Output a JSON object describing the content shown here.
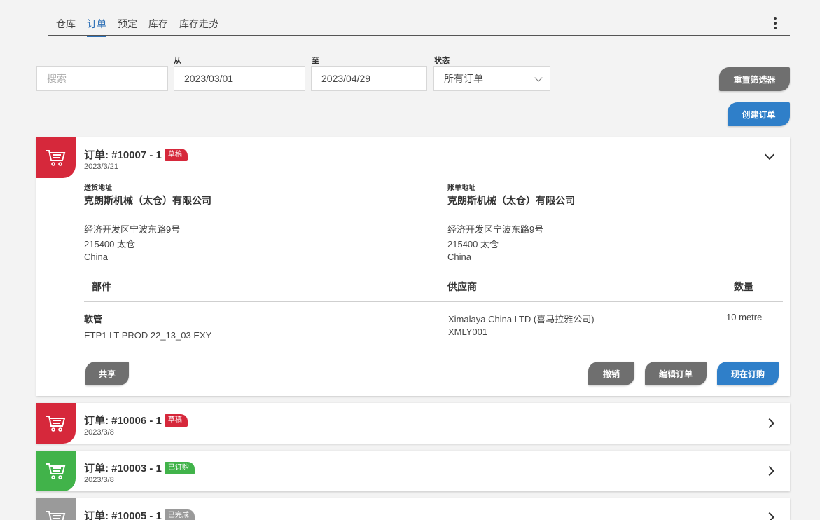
{
  "tabs": [
    {
      "label": "仓库"
    },
    {
      "label": "订单"
    },
    {
      "label": "预定"
    },
    {
      "label": "库存"
    },
    {
      "label": "库存走势"
    }
  ],
  "active_tab": "订单",
  "filters": {
    "search_placeholder": "搜索",
    "from_label": "从",
    "from_value": "2023/03/01",
    "to_label": "至",
    "to_value": "2023/04/29",
    "status_label": "状态",
    "status_value": "所有订单",
    "reset_button": "重置筛选器",
    "create_button": "创建订单"
  },
  "colors": {
    "draft": "#d6283b",
    "ordered": "#41b34a",
    "completed": "#9a9a9a",
    "accent": "#2f7fc9"
  },
  "orders": [
    {
      "title": "订单: #10007 - 1",
      "status": "草稿",
      "date": "2023/3/21",
      "expanded": true,
      "shipping_label": "送货地址",
      "shipping_name": "克朗斯机械（太仓）有限公司",
      "shipping_lines": [
        "经济开发区宁波东路9号",
        "215400 太仓",
        "China"
      ],
      "billing_label": "账单地址",
      "billing_name": "克朗斯机械（太仓）有限公司",
      "billing_lines": [
        "经济开发区宁波东路9号",
        "215400 太仓",
        "China"
      ],
      "table_headers": {
        "part": "部件",
        "supplier": "供应商",
        "qty": "数量"
      },
      "items": [
        {
          "part_name": "软管",
          "part_code": "ETP1 LT PROD 22_13_03 EXY",
          "supplier_name": "Ximalaya China LTD (喜马拉雅公司)",
          "supplier_code": "XMLY001",
          "qty": "10 metre"
        }
      ],
      "actions": {
        "share": "共享",
        "cancel": "撤销",
        "edit": "编辑订单",
        "order_now": "现在订购"
      }
    },
    {
      "title": "订单: #10006 - 1",
      "status": "草稿",
      "date": "2023/3/8",
      "expanded": false
    },
    {
      "title": "订单: #10003 - 1",
      "status": "已订购",
      "date": "2023/3/8",
      "expanded": false
    },
    {
      "title": "订单: #10005 - 1",
      "status": "已完成",
      "date": "",
      "expanded": false
    }
  ]
}
